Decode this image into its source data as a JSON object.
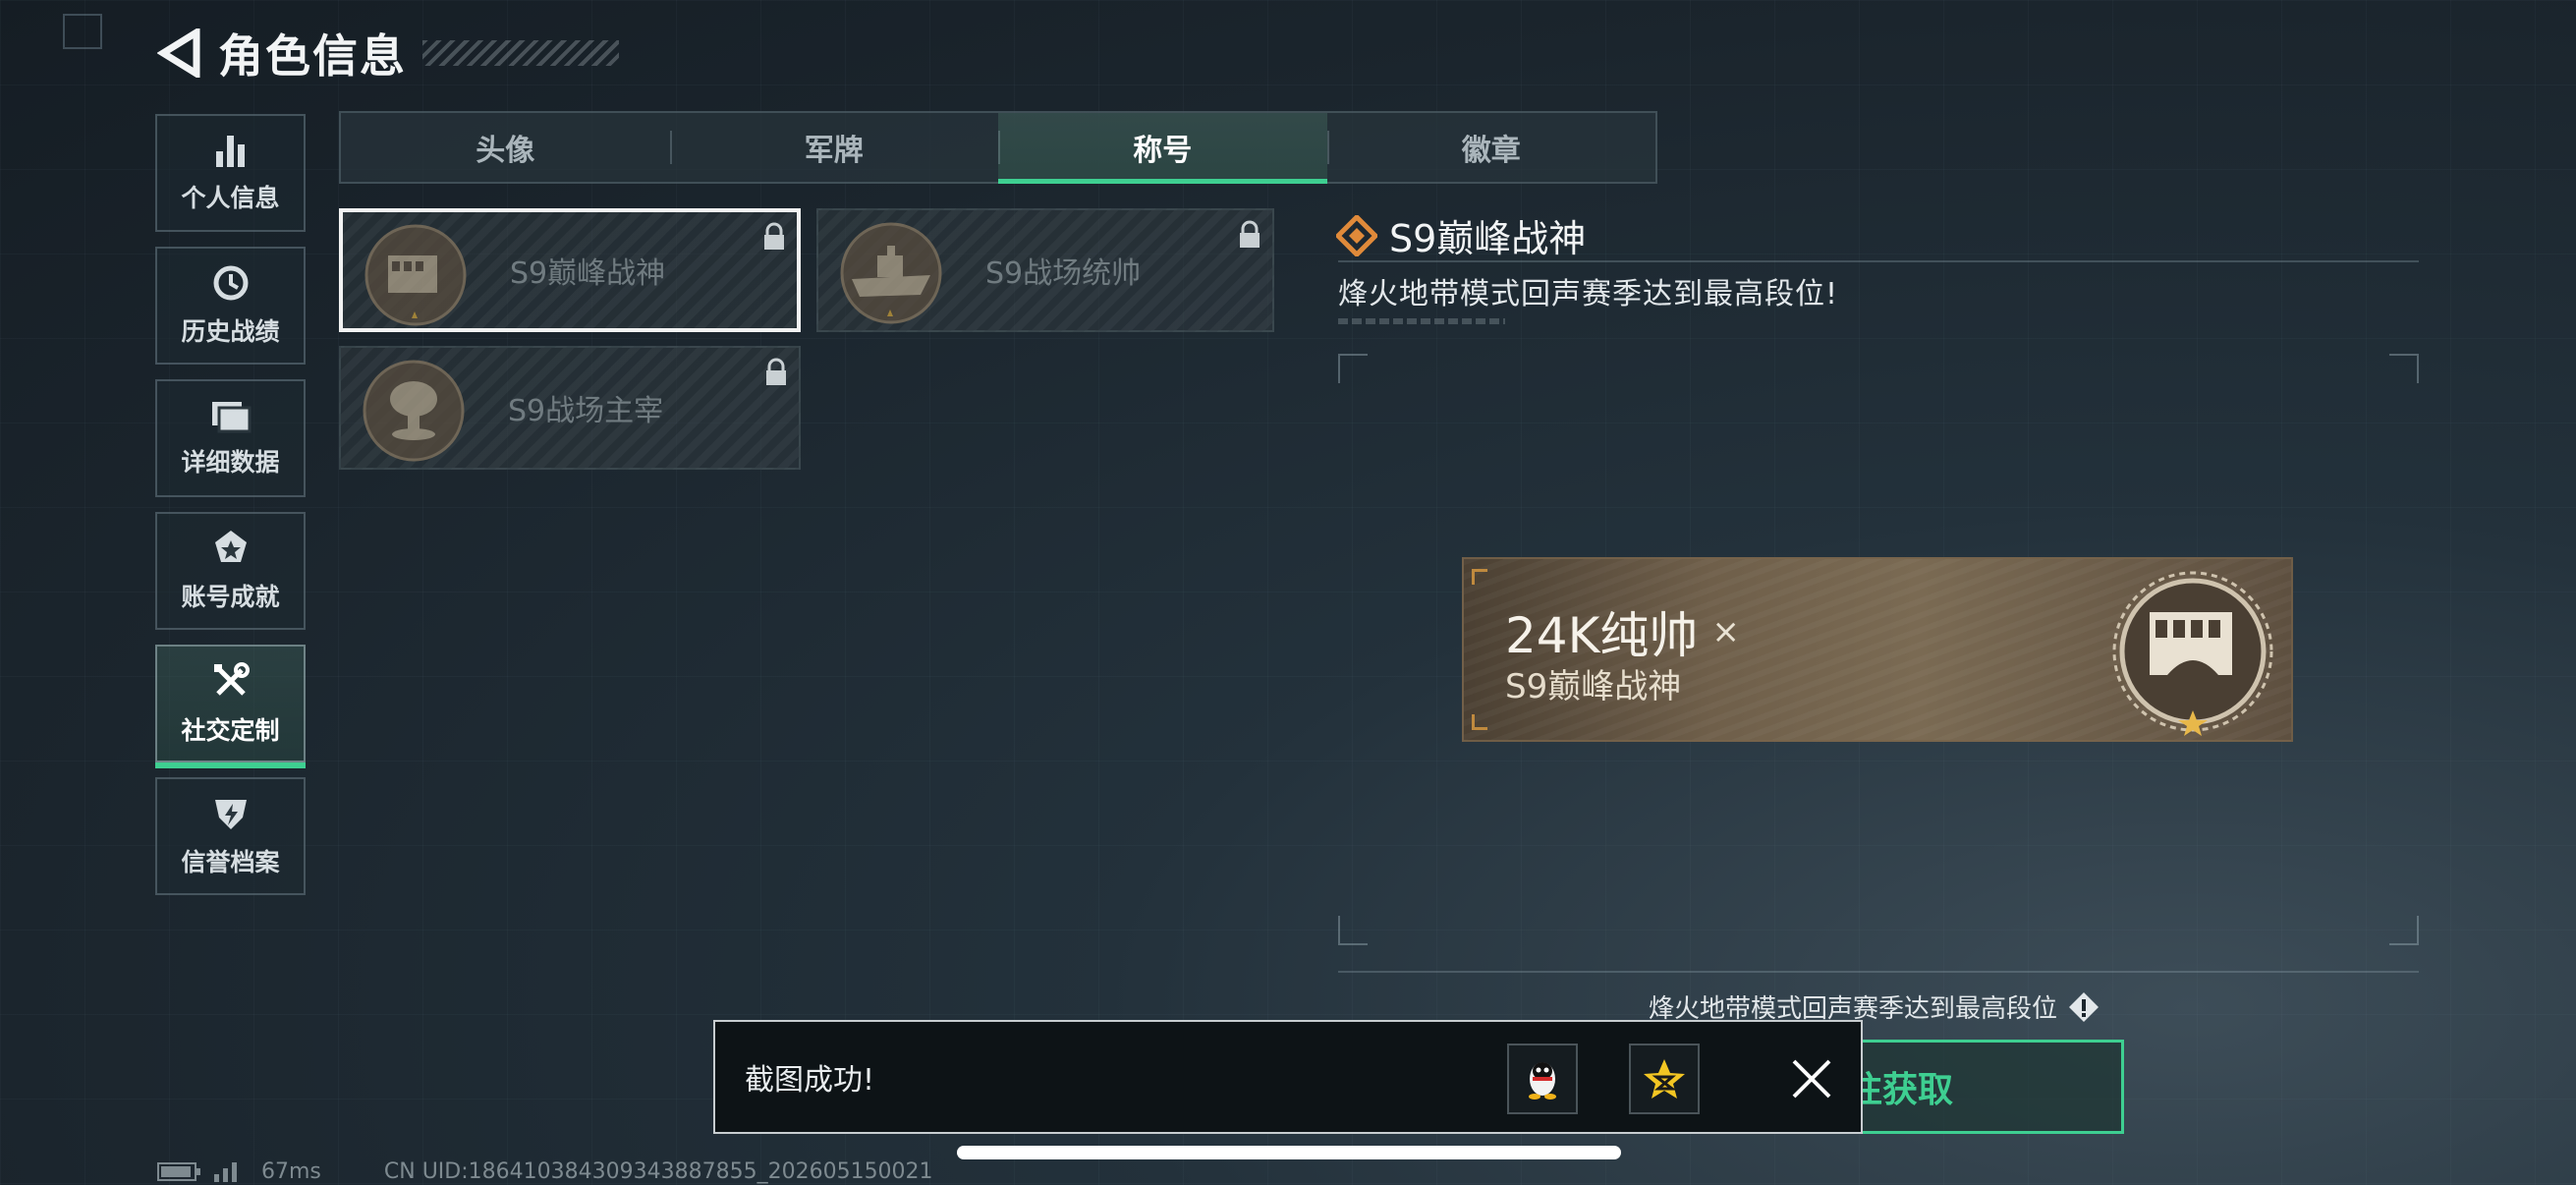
{
  "header": {
    "title": "角色信息"
  },
  "sidebar": {
    "items": [
      {
        "label": "个人信息",
        "icon": "bar-chart-icon"
      },
      {
        "label": "历史战绩",
        "icon": "history-clock-icon"
      },
      {
        "label": "详细数据",
        "icon": "folder-icon"
      },
      {
        "label": "账号成就",
        "icon": "achievement-badge-icon"
      },
      {
        "label": "社交定制",
        "icon": "tools-icon",
        "active": true
      },
      {
        "label": "信誉档案",
        "icon": "credit-shield-icon"
      }
    ]
  },
  "tabs": [
    {
      "label": "头像"
    },
    {
      "label": "军牌"
    },
    {
      "label": "称号",
      "active": true
    },
    {
      "label": "徽章"
    }
  ],
  "titles": [
    {
      "name": "S9巅峰战神",
      "locked": true,
      "selected": true
    },
    {
      "name": "S9战场统帅",
      "locked": true,
      "selected": false
    },
    {
      "name": "S9战场主宰",
      "locked": true,
      "selected": false
    }
  ],
  "detail": {
    "title": "S9巅峰战神",
    "description": "烽火地带模式回声赛季达到最高段位!",
    "preview": {
      "player_name": "24K纯帅",
      "close_mark": "×",
      "title": "S9巅峰战神"
    },
    "requirement": "烽火地带模式回声赛季达到最高段位",
    "action_label": "前往获取"
  },
  "toast": {
    "message": "截图成功!"
  },
  "status": {
    "ping": "67ms",
    "uid": "CN UID:186410384309343887855_202605150021"
  },
  "colors": {
    "accent": "#3ecf91",
    "banner": "#6f5f4a",
    "bronze": "#c08a3e"
  }
}
